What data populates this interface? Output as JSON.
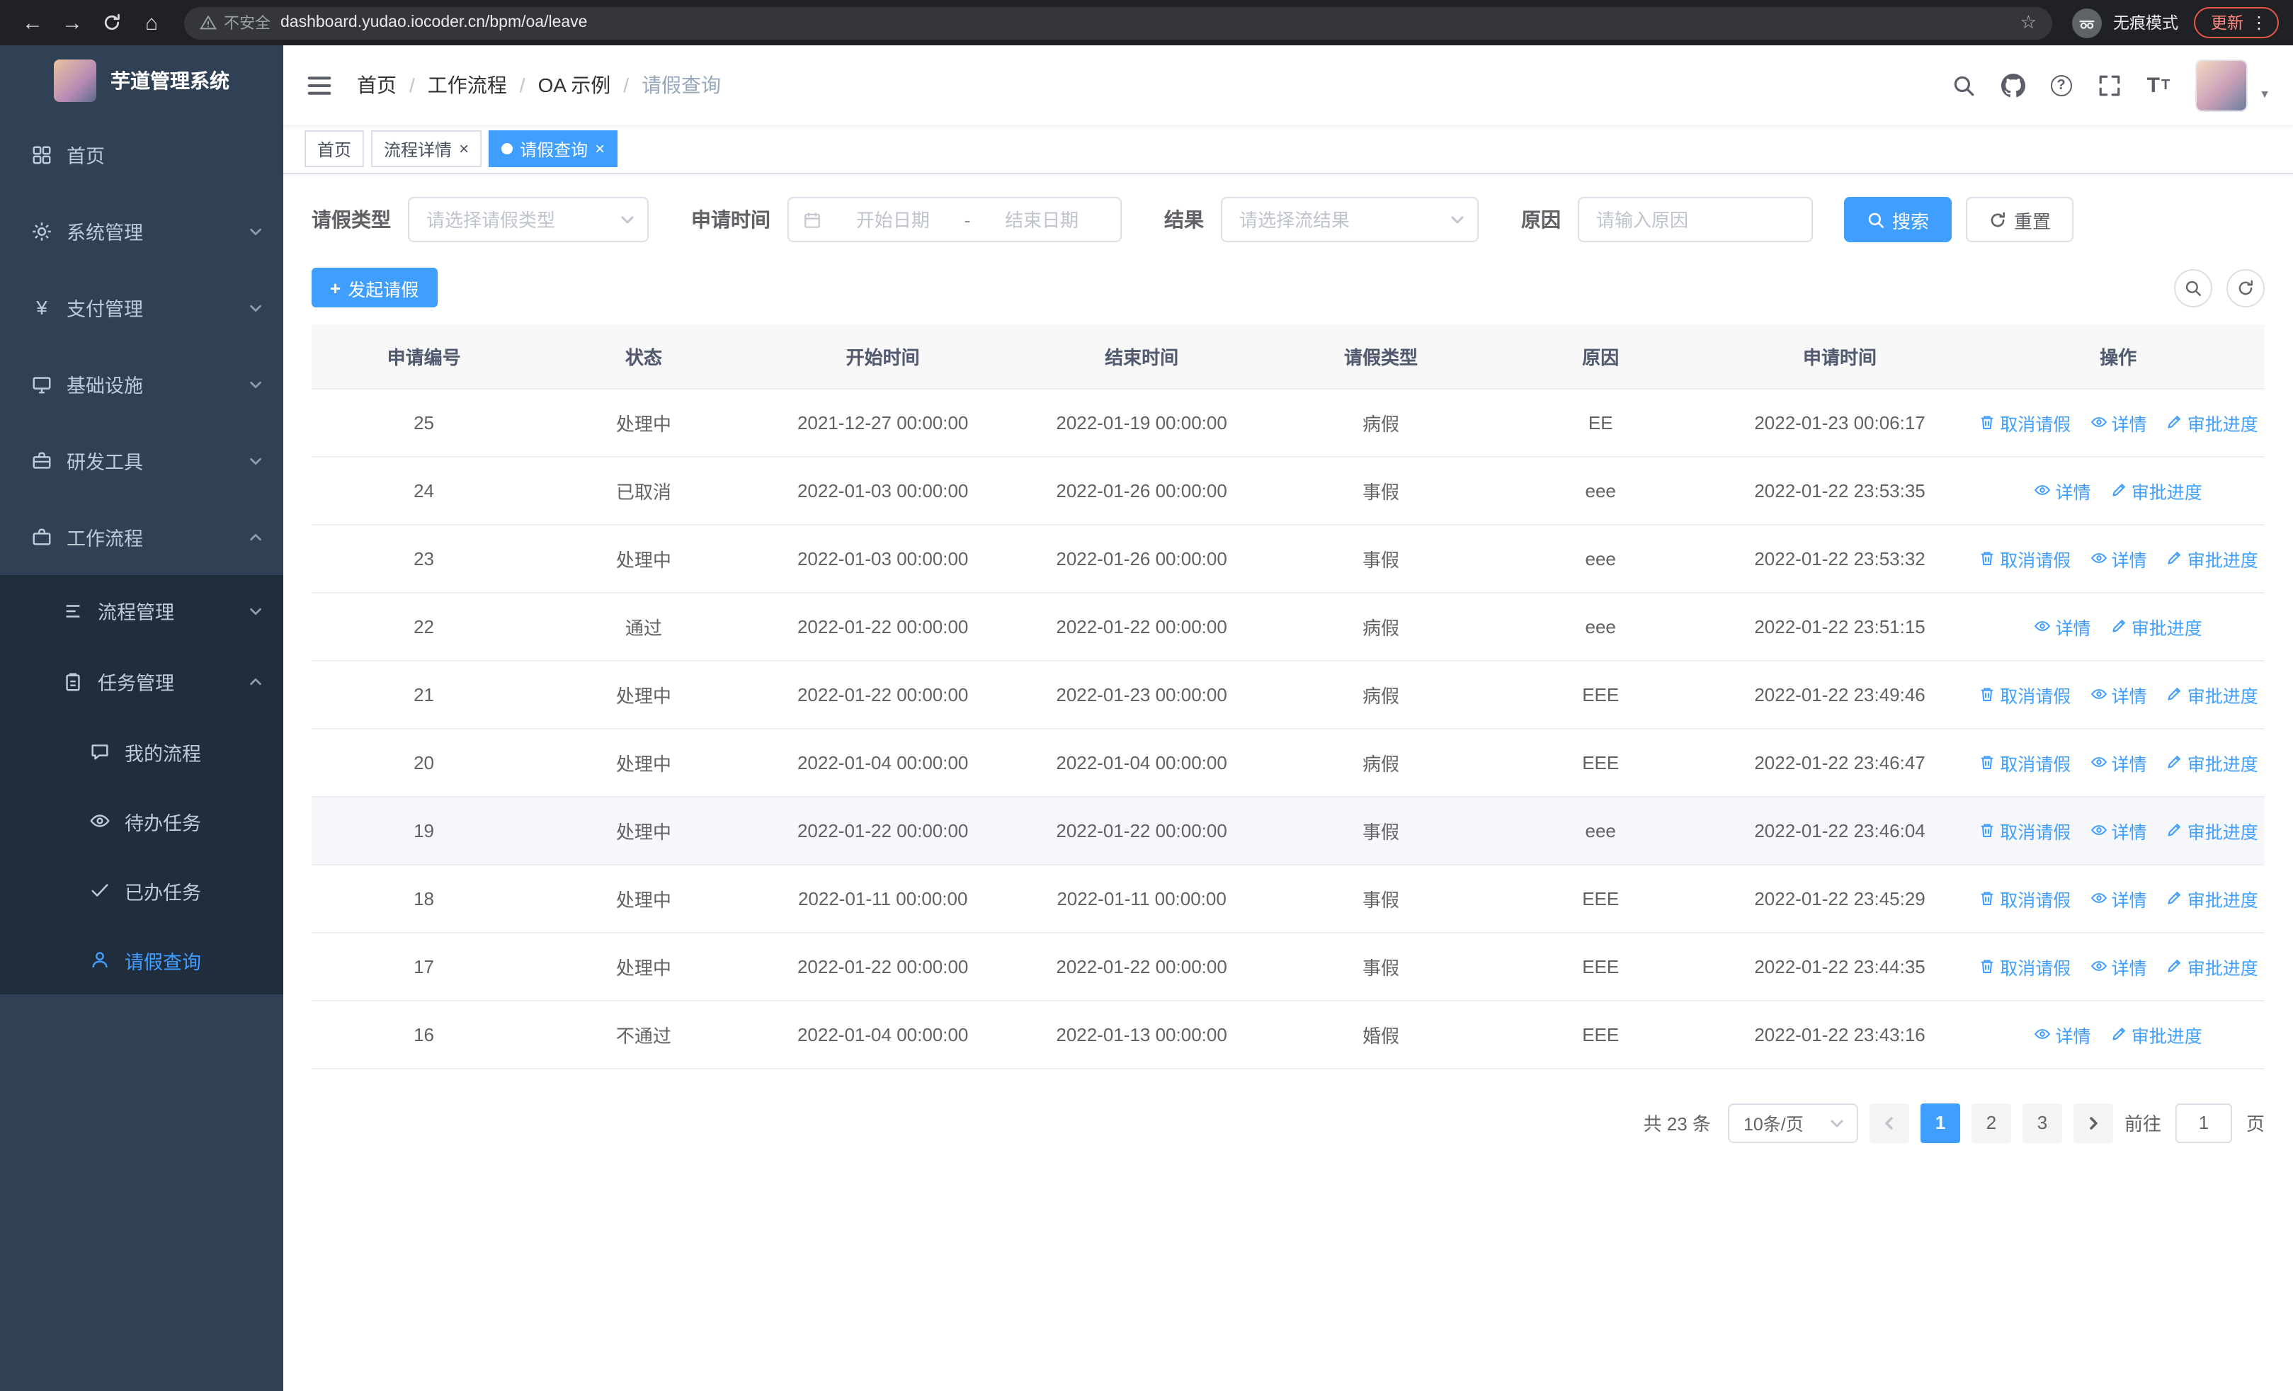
{
  "colors": {
    "primary": "#409eff",
    "sidebar_bg": "#304156",
    "sidebar_submenu_bg": "#1f2d3d",
    "chrome_bg": "#202124",
    "link": "#409eff",
    "update_red": "#e8564a",
    "table_header_bg": "#f8f8f9"
  },
  "icons": {
    "back": "←",
    "forward": "→",
    "home": "⌂",
    "star": "☆",
    "kebab": "⋮",
    "close": "×",
    "plus": "+",
    "caret_down": "▼",
    "question": "?",
    "t_large": "T",
    "t_small": "T",
    "yen": "¥"
  },
  "browser": {
    "security_label": "不安全",
    "page_url": "dashboard.yudao.iocoder.cn/bpm/oa/leave",
    "incognito_label": "无痕模式",
    "update_label": "更新"
  },
  "sidebar": {
    "logo_title": "芋道管理系统",
    "items": [
      {
        "label": "首页"
      },
      {
        "label": "系统管理",
        "expanded": false
      },
      {
        "label": "支付管理",
        "expanded": false
      },
      {
        "label": "基础设施",
        "expanded": false
      },
      {
        "label": "研发工具",
        "expanded": false
      },
      {
        "label": "工作流程",
        "expanded": true
      }
    ],
    "workflow_children": [
      {
        "label": "流程管理",
        "expanded": false
      },
      {
        "label": "任务管理",
        "expanded": true
      }
    ],
    "task_children": [
      {
        "label": "我的流程"
      },
      {
        "label": "待办任务"
      },
      {
        "label": "已办任务"
      },
      {
        "label": "请假查询",
        "active": true
      }
    ]
  },
  "navbar": {
    "breadcrumb": [
      "首页",
      "工作流程",
      "OA 示例",
      "请假查询"
    ],
    "separator": "/"
  },
  "tabs": [
    {
      "label": "首页",
      "closable": false,
      "active": false
    },
    {
      "label": "流程详情",
      "closable": true,
      "active": false
    },
    {
      "label": "请假查询",
      "closable": true,
      "active": true
    }
  ],
  "filters": {
    "leave_type": {
      "label": "请假类型",
      "placeholder": "请选择请假类型"
    },
    "apply_time": {
      "label": "申请时间",
      "start_placeholder": "开始日期",
      "separator": "-",
      "end_placeholder": "结束日期"
    },
    "result": {
      "label": "结果",
      "placeholder": "请选择流结果"
    },
    "reason": {
      "label": "原因",
      "placeholder": "请输入原因"
    },
    "search_label": "搜索",
    "reset_label": "重置"
  },
  "toolbar": {
    "create_label": "发起请假"
  },
  "table": {
    "headers": [
      "申请编号",
      "状态",
      "开始时间",
      "结束时间",
      "请假类型",
      "原因",
      "申请时间",
      "操作"
    ],
    "rows": [
      {
        "id": "25",
        "status": "处理中",
        "start": "2021-12-27 00:00:00",
        "end": "2022-01-19 00:00:00",
        "type": "病假",
        "reason": "EE",
        "applied": "2022-01-23 00:06:17",
        "actions": {
          "cancel": "取消请假",
          "detail": "详情",
          "progress": "审批进度"
        }
      },
      {
        "id": "24",
        "status": "已取消",
        "start": "2022-01-03 00:00:00",
        "end": "2022-01-26 00:00:00",
        "type": "事假",
        "reason": "eee",
        "applied": "2022-01-22 23:53:35",
        "actions": {
          "detail": "详情",
          "progress": "审批进度"
        }
      },
      {
        "id": "23",
        "status": "处理中",
        "start": "2022-01-03 00:00:00",
        "end": "2022-01-26 00:00:00",
        "type": "事假",
        "reason": "eee",
        "applied": "2022-01-22 23:53:32",
        "actions": {
          "cancel": "取消请假",
          "detail": "详情",
          "progress": "审批进度"
        }
      },
      {
        "id": "22",
        "status": "通过",
        "start": "2022-01-22 00:00:00",
        "end": "2022-01-22 00:00:00",
        "type": "病假",
        "reason": "eee",
        "applied": "2022-01-22 23:51:15",
        "actions": {
          "detail": "详情",
          "progress": "审批进度"
        }
      },
      {
        "id": "21",
        "status": "处理中",
        "start": "2022-01-22 00:00:00",
        "end": "2022-01-23 00:00:00",
        "type": "病假",
        "reason": "EEE",
        "applied": "2022-01-22 23:49:46",
        "actions": {
          "cancel": "取消请假",
          "detail": "详情",
          "progress": "审批进度"
        }
      },
      {
        "id": "20",
        "status": "处理中",
        "start": "2022-01-04 00:00:00",
        "end": "2022-01-04 00:00:00",
        "type": "病假",
        "reason": "EEE",
        "applied": "2022-01-22 23:46:47",
        "actions": {
          "cancel": "取消请假",
          "detail": "详情",
          "progress": "审批进度"
        }
      },
      {
        "id": "19",
        "status": "处理中",
        "start": "2022-01-22 00:00:00",
        "end": "2022-01-22 00:00:00",
        "type": "事假",
        "reason": "eee",
        "applied": "2022-01-22 23:46:04",
        "hover": true,
        "actions": {
          "cancel": "取消请假",
          "detail": "详情",
          "progress": "审批进度"
        }
      },
      {
        "id": "18",
        "status": "处理中",
        "start": "2022-01-11 00:00:00",
        "end": "2022-01-11 00:00:00",
        "type": "事假",
        "reason": "EEE",
        "applied": "2022-01-22 23:45:29",
        "actions": {
          "cancel": "取消请假",
          "detail": "详情",
          "progress": "审批进度"
        }
      },
      {
        "id": "17",
        "status": "处理中",
        "start": "2022-01-22 00:00:00",
        "end": "2022-01-22 00:00:00",
        "type": "事假",
        "reason": "EEE",
        "applied": "2022-01-22 23:44:35",
        "actions": {
          "cancel": "取消请假",
          "detail": "详情",
          "progress": "审批进度"
        }
      },
      {
        "id": "16",
        "status": "不通过",
        "start": "2022-01-04 00:00:00",
        "end": "2022-01-13 00:00:00",
        "type": "婚假",
        "reason": "EEE",
        "applied": "2022-01-22 23:43:16",
        "actions": {
          "detail": "详情",
          "progress": "审批进度"
        }
      }
    ]
  },
  "pagination": {
    "total": "共 23 条",
    "page_size": "10条/页",
    "pages": [
      {
        "label": "1",
        "active": true
      },
      {
        "label": "2"
      },
      {
        "label": "3"
      }
    ],
    "goto_label": "前往",
    "goto_value": "1",
    "page_unit": "页"
  }
}
